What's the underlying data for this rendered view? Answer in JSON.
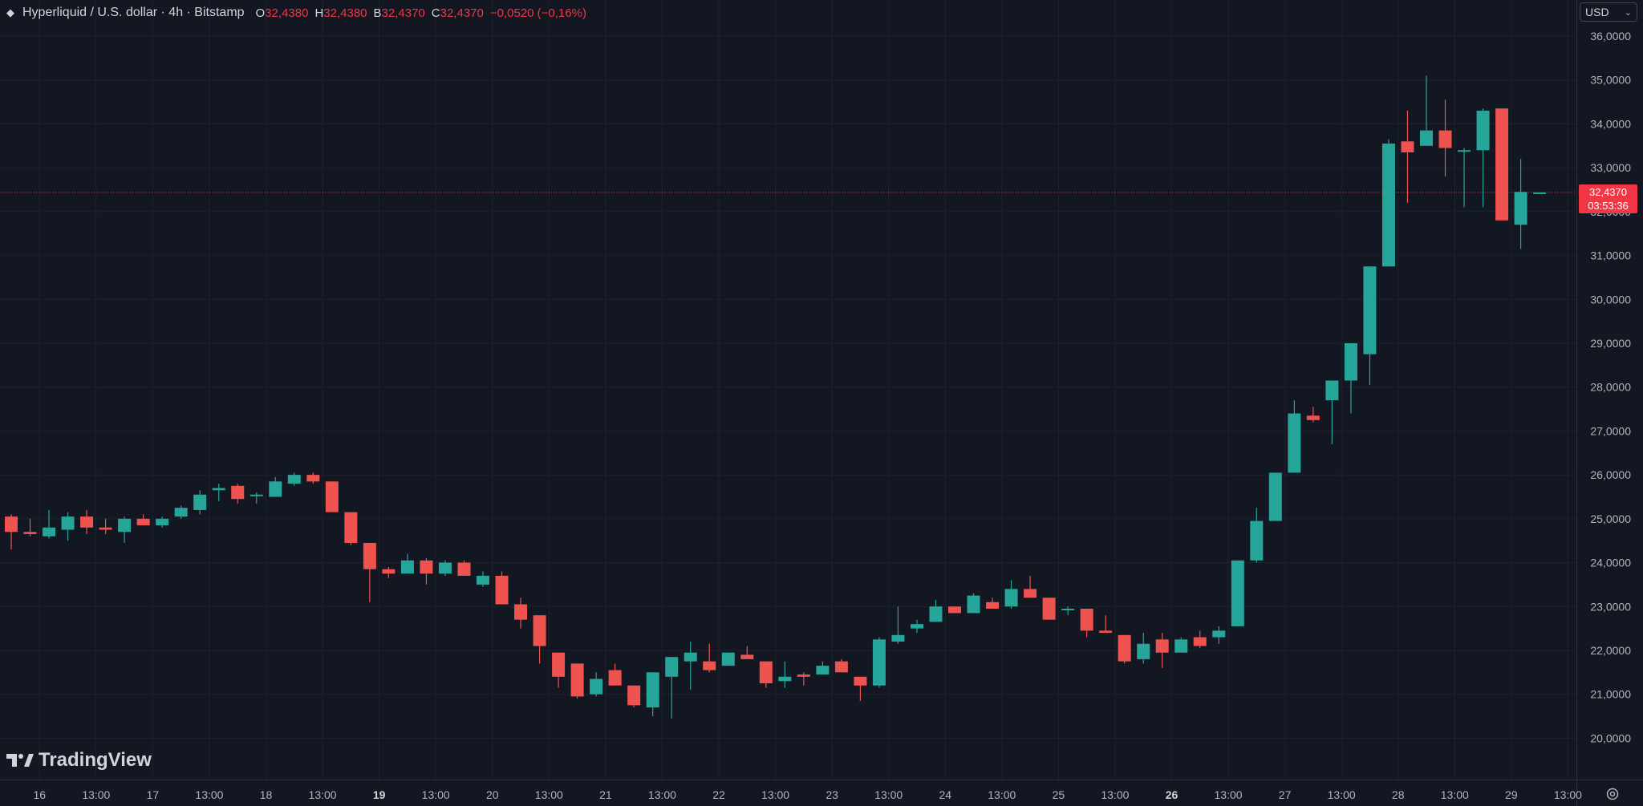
{
  "header": {
    "symbol_title": "Hyperliquid / U.S. dollar · 4h · Bitstamp",
    "ohlc": [
      {
        "key": "O",
        "value": "32,4380"
      },
      {
        "key": "H",
        "value": "32,4380"
      },
      {
        "key": "B",
        "value": "32,4370"
      },
      {
        "key": "C",
        "value": "32,4370"
      }
    ],
    "change": "−0,0520 (−0,16%)",
    "currency": "USD"
  },
  "last_price": {
    "label": "32,4370",
    "countdown": "03:53:36",
    "value": 32437
  },
  "brand": {
    "name": "TradingView"
  },
  "colors": {
    "background": "#131722",
    "grid": "#1e222d",
    "up": "#26a69a",
    "down": "#ef5350",
    "axis_text": "#b2b5be",
    "price_line": "#f23645"
  },
  "chart_data": {
    "type": "candlestick",
    "interval": "4h",
    "ylim": [
      19300,
      36500
    ],
    "y_ticks": [
      {
        "value": 36000,
        "label": "36,0000"
      },
      {
        "value": 35000,
        "label": "35,0000"
      },
      {
        "value": 34000,
        "label": "34,0000"
      },
      {
        "value": 33000,
        "label": "33,0000"
      },
      {
        "value": 32000,
        "label": "32,0000"
      },
      {
        "value": 31000,
        "label": "31,0000"
      },
      {
        "value": 30000,
        "label": "30,0000"
      },
      {
        "value": 29000,
        "label": "29,0000"
      },
      {
        "value": 28000,
        "label": "28,0000"
      },
      {
        "value": 27000,
        "label": "27,0000"
      },
      {
        "value": 26000,
        "label": "26,0000"
      },
      {
        "value": 25000,
        "label": "25,0000"
      },
      {
        "value": 24000,
        "label": "24,0000"
      },
      {
        "value": 23000,
        "label": "23,0000"
      },
      {
        "value": 22000,
        "label": "22,0000"
      },
      {
        "value": 21000,
        "label": "21,0000"
      },
      {
        "value": 20000,
        "label": "20,0000"
      }
    ],
    "x_ticks": [
      {
        "index": 1.5,
        "label": "16",
        "bold": false
      },
      {
        "index": 4.5,
        "label": "13:00",
        "bold": false
      },
      {
        "index": 7.5,
        "label": "17",
        "bold": false
      },
      {
        "index": 10.5,
        "label": "13:00",
        "bold": false
      },
      {
        "index": 13.5,
        "label": "18",
        "bold": false
      },
      {
        "index": 16.5,
        "label": "13:00",
        "bold": false
      },
      {
        "index": 19.5,
        "label": "19",
        "bold": true
      },
      {
        "index": 22.5,
        "label": "13:00",
        "bold": false
      },
      {
        "index": 25.5,
        "label": "20",
        "bold": false
      },
      {
        "index": 28.5,
        "label": "13:00",
        "bold": false
      },
      {
        "index": 31.5,
        "label": "21",
        "bold": false
      },
      {
        "index": 34.5,
        "label": "13:00",
        "bold": false
      },
      {
        "index": 37.5,
        "label": "22",
        "bold": false
      },
      {
        "index": 40.5,
        "label": "13:00",
        "bold": false
      },
      {
        "index": 43.5,
        "label": "23",
        "bold": false
      },
      {
        "index": 46.5,
        "label": "13:00",
        "bold": false
      },
      {
        "index": 49.5,
        "label": "24",
        "bold": false
      },
      {
        "index": 52.5,
        "label": "13:00",
        "bold": false
      },
      {
        "index": 55.5,
        "label": "25",
        "bold": false
      },
      {
        "index": 58.5,
        "label": "13:00",
        "bold": false
      },
      {
        "index": 61.5,
        "label": "26",
        "bold": true
      },
      {
        "index": 64.5,
        "label": "13:00",
        "bold": false
      },
      {
        "index": 67.5,
        "label": "27",
        "bold": false
      },
      {
        "index": 70.5,
        "label": "13:00",
        "bold": false
      },
      {
        "index": 73.5,
        "label": "28",
        "bold": false
      },
      {
        "index": 76.5,
        "label": "13:00",
        "bold": false
      },
      {
        "index": 79.5,
        "label": "29",
        "bold": false
      },
      {
        "index": 82.5,
        "label": "13:00",
        "bold": false
      }
    ],
    "candles": [
      {
        "o": 25050,
        "h": 25100,
        "l": 24300,
        "c": 24700
      },
      {
        "o": 24700,
        "h": 25000,
        "l": 24600,
        "c": 24650
      },
      {
        "o": 24600,
        "h": 25200,
        "l": 24550,
        "c": 24800
      },
      {
        "o": 24750,
        "h": 25150,
        "l": 24500,
        "c": 25050
      },
      {
        "o": 25050,
        "h": 25200,
        "l": 24650,
        "c": 24800
      },
      {
        "o": 24800,
        "h": 25000,
        "l": 24650,
        "c": 24750
      },
      {
        "o": 24700,
        "h": 25050,
        "l": 24450,
        "c": 25000
      },
      {
        "o": 25000,
        "h": 25100,
        "l": 24850,
        "c": 24850
      },
      {
        "o": 24850,
        "h": 25050,
        "l": 24800,
        "c": 25000
      },
      {
        "o": 25050,
        "h": 25300,
        "l": 25000,
        "c": 25250
      },
      {
        "o": 25200,
        "h": 25650,
        "l": 25100,
        "c": 25550
      },
      {
        "o": 25650,
        "h": 25800,
        "l": 25400,
        "c": 25700
      },
      {
        "o": 25750,
        "h": 25800,
        "l": 25350,
        "c": 25450
      },
      {
        "o": 25550,
        "h": 25600,
        "l": 25350,
        "c": 25550
      },
      {
        "o": 25500,
        "h": 25950,
        "l": 25500,
        "c": 25850
      },
      {
        "o": 25800,
        "h": 26050,
        "l": 25750,
        "c": 26000
      },
      {
        "o": 26000,
        "h": 26050,
        "l": 25800,
        "c": 25850
      },
      {
        "o": 25850,
        "h": 25850,
        "l": 25150,
        "c": 25150
      },
      {
        "o": 25150,
        "h": 25150,
        "l": 24400,
        "c": 24450
      },
      {
        "o": 24450,
        "h": 24450,
        "l": 23100,
        "c": 23850
      },
      {
        "o": 23850,
        "h": 23900,
        "l": 23650,
        "c": 23750
      },
      {
        "o": 23750,
        "h": 24200,
        "l": 23750,
        "c": 24050
      },
      {
        "o": 24050,
        "h": 24100,
        "l": 23500,
        "c": 23750
      },
      {
        "o": 23750,
        "h": 24050,
        "l": 23700,
        "c": 24000
      },
      {
        "o": 24000,
        "h": 24050,
        "l": 23700,
        "c": 23700
      },
      {
        "o": 23500,
        "h": 23800,
        "l": 23450,
        "c": 23700
      },
      {
        "o": 23700,
        "h": 23800,
        "l": 23050,
        "c": 23050
      },
      {
        "o": 23050,
        "h": 23200,
        "l": 22500,
        "c": 22700
      },
      {
        "o": 22800,
        "h": 22800,
        "l": 21700,
        "c": 22100
      },
      {
        "o": 21950,
        "h": 21950,
        "l": 21150,
        "c": 21400
      },
      {
        "o": 21700,
        "h": 21700,
        "l": 20900,
        "c": 20950
      },
      {
        "o": 21000,
        "h": 21500,
        "l": 20950,
        "c": 21350
      },
      {
        "o": 21550,
        "h": 21700,
        "l": 21200,
        "c": 21200
      },
      {
        "o": 21200,
        "h": 21200,
        "l": 20700,
        "c": 20750
      },
      {
        "o": 20700,
        "h": 21500,
        "l": 20500,
        "c": 21500
      },
      {
        "o": 21400,
        "h": 21850,
        "l": 20450,
        "c": 21850
      },
      {
        "o": 21750,
        "h": 22200,
        "l": 21100,
        "c": 21950
      },
      {
        "o": 21750,
        "h": 22150,
        "l": 21500,
        "c": 21550
      },
      {
        "o": 21650,
        "h": 21950,
        "l": 21650,
        "c": 21950
      },
      {
        "o": 21900,
        "h": 22100,
        "l": 21800,
        "c": 21800
      },
      {
        "o": 21750,
        "h": 21750,
        "l": 21150,
        "c": 21250
      },
      {
        "o": 21300,
        "h": 21750,
        "l": 21150,
        "c": 21400
      },
      {
        "o": 21450,
        "h": 21500,
        "l": 21200,
        "c": 21400
      },
      {
        "o": 21450,
        "h": 21750,
        "l": 21450,
        "c": 21650
      },
      {
        "o": 21750,
        "h": 21800,
        "l": 21500,
        "c": 21500
      },
      {
        "o": 21400,
        "h": 21400,
        "l": 20850,
        "c": 21200
      },
      {
        "o": 21200,
        "h": 22300,
        "l": 21150,
        "c": 22250
      },
      {
        "o": 22200,
        "h": 23000,
        "l": 22150,
        "c": 22350
      },
      {
        "o": 22500,
        "h": 22700,
        "l": 22400,
        "c": 22600
      },
      {
        "o": 22650,
        "h": 23150,
        "l": 22650,
        "c": 23000
      },
      {
        "o": 23000,
        "h": 23000,
        "l": 22850,
        "c": 22850
      },
      {
        "o": 22850,
        "h": 23300,
        "l": 22850,
        "c": 23250
      },
      {
        "o": 23100,
        "h": 23200,
        "l": 22950,
        "c": 22950
      },
      {
        "o": 23000,
        "h": 23600,
        "l": 22950,
        "c": 23400
      },
      {
        "o": 23400,
        "h": 23700,
        "l": 23200,
        "c": 23200
      },
      {
        "o": 23200,
        "h": 23200,
        "l": 22700,
        "c": 22700
      },
      {
        "o": 22950,
        "h": 23000,
        "l": 22800,
        "c": 22950
      },
      {
        "o": 22950,
        "h": 22950,
        "l": 22300,
        "c": 22450
      },
      {
        "o": 22450,
        "h": 22800,
        "l": 22400,
        "c": 22400
      },
      {
        "o": 22350,
        "h": 22350,
        "l": 21700,
        "c": 21750
      },
      {
        "o": 21800,
        "h": 22400,
        "l": 21700,
        "c": 22150
      },
      {
        "o": 22250,
        "h": 22400,
        "l": 21600,
        "c": 21950
      },
      {
        "o": 21950,
        "h": 22300,
        "l": 21950,
        "c": 22250
      },
      {
        "o": 22300,
        "h": 22450,
        "l": 22050,
        "c": 22100
      },
      {
        "o": 22300,
        "h": 22550,
        "l": 22150,
        "c": 22450
      },
      {
        "o": 22550,
        "h": 24050,
        "l": 22550,
        "c": 24050
      },
      {
        "o": 24050,
        "h": 25250,
        "l": 24000,
        "c": 24950
      },
      {
        "o": 24950,
        "h": 25850,
        "l": 24950,
        "c": 26050
      },
      {
        "o": 26050,
        "h": 27700,
        "l": 26050,
        "c": 27400
      },
      {
        "o": 27350,
        "h": 27550,
        "l": 27200,
        "c": 27250
      },
      {
        "o": 27700,
        "h": 28000,
        "l": 26700,
        "c": 28150
      },
      {
        "o": 28150,
        "h": 29000,
        "l": 27400,
        "c": 29000
      },
      {
        "o": 28750,
        "h": 30750,
        "l": 28050,
        "c": 30750
      },
      {
        "o": 30750,
        "h": 33650,
        "l": 30750,
        "c": 33550
      },
      {
        "o": 33600,
        "h": 34300,
        "l": 32200,
        "c": 33350
      },
      {
        "o": 33500,
        "h": 35100,
        "l": 33500,
        "c": 33850
      },
      {
        "o": 33850,
        "h": 34550,
        "l": 32800,
        "c": 33450
      },
      {
        "o": 33400,
        "h": 33450,
        "l": 32100,
        "c": 33400
      },
      {
        "o": 33400,
        "h": 34350,
        "l": 32100,
        "c": 34300
      },
      {
        "o": 34350,
        "h": 34350,
        "l": 31800,
        "c": 31800
      },
      {
        "o": 31700,
        "h": 33200,
        "l": 31150,
        "c": 32450
      },
      {
        "o": 32437,
        "h": 32437,
        "l": 32437,
        "c": 32437
      }
    ]
  }
}
